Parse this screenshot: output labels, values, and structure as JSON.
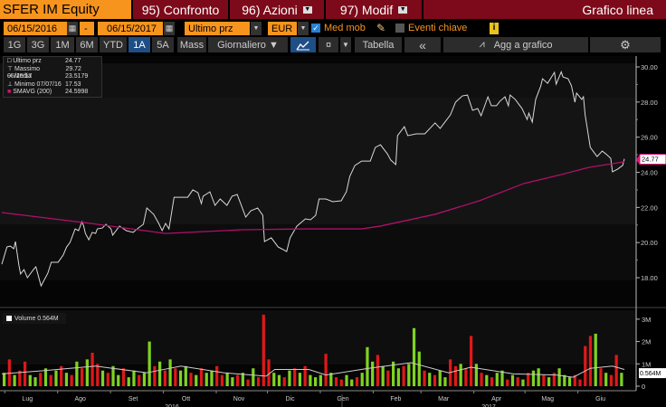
{
  "header": {
    "ticker": "SFER IM Equity",
    "compare": "95) Confronto",
    "actions": "96) Azioni",
    "modify": "97) Modif",
    "chart_type": "Grafico linea"
  },
  "controls": {
    "start_date": "06/15/2016",
    "dash": "-",
    "end_date": "06/15/2017",
    "field": "Ultimo prz",
    "currency": "EUR",
    "moving_avg_label": "Med mob",
    "moving_avg_checked": true,
    "key_events_label": "Eventi chiave",
    "key_events_checked": false,
    "info": "i"
  },
  "toolbar": {
    "periods": [
      "1G",
      "3G",
      "1M",
      "6M",
      "YTD",
      "1A",
      "5A",
      "Mass"
    ],
    "active_period": "1A",
    "frequency": "Giornaliero ▼",
    "table": "Tabella",
    "collapse": "«",
    "add_to_chart": "Agg a grafico"
  },
  "legend": {
    "items": [
      {
        "label": "Ultimo prz",
        "value": "24.77",
        "color": "#ffffff"
      },
      {
        "label": "Massimo 05/10/17",
        "value": "29.72"
      },
      {
        "label": "Media",
        "value": "23.5179"
      },
      {
        "label": "Minimo 07/07/16",
        "value": "17.53"
      },
      {
        "label": "SMAVG (200)",
        "value": "24.5998",
        "color": "#e0107a"
      }
    ]
  },
  "volume_legend": "Volume 0.564M",
  "chart_data": [
    {
      "type": "line",
      "title": "SFER IM Equity - Ultimo prz",
      "x_unit": "days since 06/15/2016",
      "ylim": [
        17,
        30.8
      ],
      "y_ticks": [
        "18.00",
        "20.00",
        "22.00",
        "24.00",
        "26.00",
        "28.00",
        "30.00"
      ],
      "y_tick_values": [
        18,
        20,
        22,
        24,
        26,
        28,
        30
      ],
      "last_label": "24.77",
      "series": [
        {
          "name": "Ultimo prz",
          "color": "#d8d8d8",
          "points": [
            [
              0,
              18.77
            ],
            [
              3,
              19.75
            ],
            [
              5,
              19.8
            ],
            [
              7,
              19.65
            ],
            [
              8,
              20.06
            ],
            [
              10,
              18.72
            ],
            [
              11,
              18.21
            ],
            [
              13,
              18.46
            ],
            [
              15,
              18.0
            ],
            [
              19,
              18.52
            ],
            [
              20,
              18.62
            ],
            [
              23,
              17.53
            ],
            [
              27,
              18.26
            ],
            [
              29,
              18.88
            ],
            [
              33,
              18.88
            ],
            [
              36,
              19.29
            ],
            [
              38,
              19.75
            ],
            [
              40,
              20.01
            ],
            [
              43,
              20.78
            ],
            [
              45,
              20.68
            ],
            [
              47,
              21.19
            ],
            [
              48,
              20.94
            ],
            [
              49,
              20.52
            ],
            [
              51,
              20.16
            ],
            [
              53,
              20.58
            ],
            [
              55,
              20.52
            ],
            [
              56,
              20.78
            ],
            [
              59,
              20.83
            ],
            [
              61,
              21.04
            ],
            [
              64,
              20.78
            ],
            [
              65,
              20.42
            ],
            [
              69,
              20.94
            ],
            [
              73,
              20.68
            ],
            [
              77,
              20.58
            ],
            [
              80,
              20.83
            ],
            [
              83,
              21.04
            ],
            [
              85,
              21.97
            ],
            [
              89,
              21.61
            ],
            [
              92,
              21.09
            ],
            [
              94,
              20.68
            ],
            [
              96,
              21.09
            ],
            [
              98,
              20.78
            ],
            [
              101,
              22.58
            ],
            [
              105,
              22.58
            ],
            [
              109,
              22.58
            ],
            [
              112,
              23.0
            ],
            [
              115,
              22.84
            ],
            [
              117,
              22.22
            ],
            [
              118,
              22.64
            ],
            [
              122,
              22.89
            ],
            [
              125,
              22.12
            ],
            [
              128,
              22.48
            ],
            [
              132,
              22.12
            ],
            [
              135,
              22.64
            ],
            [
              138,
              22.74
            ],
            [
              141,
              21.97
            ],
            [
              143,
              21.45
            ],
            [
              146,
              21.81
            ],
            [
              150,
              21.97
            ],
            [
              153,
              21.55
            ],
            [
              154,
              20.06
            ],
            [
              158,
              20.27
            ],
            [
              162,
              19.75
            ],
            [
              164,
              19.65
            ],
            [
              167,
              19.49
            ],
            [
              169,
              20.27
            ],
            [
              173,
              20.94
            ],
            [
              178,
              21.35
            ],
            [
              181,
              21.3
            ],
            [
              184,
              21.55
            ],
            [
              186,
              22.48
            ],
            [
              190,
              22.48
            ],
            [
              194,
              22.33
            ],
            [
              199,
              22.38
            ],
            [
              202,
              22.89
            ],
            [
              204,
              23.77
            ],
            [
              207,
              24.39
            ],
            [
              211,
              24.64
            ],
            [
              216,
              24.64
            ],
            [
              219,
              25.42
            ],
            [
              222,
              25.57
            ],
            [
              224,
              25.31
            ],
            [
              226,
              25.06
            ],
            [
              228,
              24.7
            ],
            [
              231,
              24.44
            ],
            [
              232,
              26.09
            ],
            [
              236,
              26.6
            ],
            [
              238,
              26.09
            ],
            [
              243,
              26.19
            ],
            [
              248,
              26.19
            ],
            [
              254,
              26.81
            ],
            [
              257,
              26.5
            ],
            [
              263,
              27.27
            ],
            [
              266,
              27.99
            ],
            [
              270,
              28.35
            ],
            [
              273,
              28.4
            ],
            [
              276,
              27.53
            ],
            [
              279,
              27.63
            ],
            [
              281,
              27.22
            ],
            [
              285,
              28.3
            ],
            [
              287,
              27.79
            ],
            [
              290,
              27.79
            ],
            [
              292,
              28.04
            ],
            [
              295,
              28.3
            ],
            [
              297,
              27.79
            ],
            [
              298,
              28.4
            ],
            [
              301,
              28.15
            ],
            [
              305,
              27.63
            ],
            [
              308,
              27.01
            ],
            [
              309,
              27.37
            ],
            [
              311,
              26.86
            ],
            [
              313,
              28.15
            ],
            [
              316,
              28.92
            ],
            [
              317,
              29.33
            ],
            [
              320,
              29.07
            ],
            [
              324,
              29.69
            ],
            [
              325,
              29.02
            ],
            [
              328,
              29.72
            ],
            [
              329,
              29.43
            ],
            [
              332,
              29.33
            ],
            [
              334,
              28.92
            ],
            [
              336,
              27.99
            ],
            [
              337,
              28.51
            ],
            [
              340,
              28.15
            ],
            [
              341,
              28.3
            ],
            [
              342,
              27.27
            ],
            [
              345,
              25.42
            ],
            [
              349,
              24.9
            ],
            [
              352,
              25.21
            ],
            [
              354,
              25.06
            ],
            [
              357,
              24.8
            ],
            [
              358,
              24.03
            ],
            [
              361,
              24.18
            ],
            [
              364,
              24.39
            ],
            [
              365,
              24.77
            ]
          ]
        },
        {
          "name": "SMAVG (200)",
          "color": "#b0106a",
          "points": [
            [
              0,
              21.71
            ],
            [
              52,
              21.09
            ],
            [
              96,
              20.52
            ],
            [
              141,
              20.73
            ],
            [
              179,
              20.78
            ],
            [
              211,
              20.78
            ],
            [
              222,
              20.94
            ],
            [
              254,
              21.61
            ],
            [
              280,
              22.38
            ],
            [
              306,
              23.36
            ],
            [
              328,
              23.87
            ],
            [
              344,
              24.28
            ],
            [
              365,
              24.6
            ]
          ]
        }
      ]
    },
    {
      "type": "bar",
      "title": "Volume",
      "ylim": [
        0,
        3.4
      ],
      "y_ticks": [
        "0",
        "1M",
        "2M",
        "3M"
      ],
      "y_tick_values": [
        0,
        1,
        2,
        3
      ],
      "last_label": "0.564M",
      "values": [
        0.6,
        1.2,
        0.5,
        0.7,
        1.1,
        0.5,
        0.4,
        0.6,
        0.8,
        0.5,
        0.7,
        0.9,
        0.6,
        0.5,
        1.1,
        0.8,
        1.2,
        1.5,
        1.0,
        0.7,
        0.6,
        0.9,
        0.5,
        0.8,
        0.4,
        0.7,
        0.5,
        0.6,
        2.0,
        0.9,
        1.1,
        0.7,
        1.2,
        0.8,
        0.7,
        0.9,
        0.6,
        0.5,
        0.8,
        0.6,
        0.7,
        0.9,
        0.5,
        0.6,
        0.4,
        0.5,
        0.6,
        0.3,
        0.8,
        0.4,
        3.2,
        1.2,
        0.6,
        0.5,
        0.4,
        0.7,
        0.8,
        0.6,
        0.9,
        0.5,
        0.4,
        0.5,
        1.45,
        0.6,
        0.4,
        0.3,
        0.5,
        0.3,
        0.4,
        0.6,
        1.75,
        1.1,
        1.4,
        0.9,
        0.7,
        1.1,
        0.8,
        0.9,
        1.0,
        2.6,
        1.55,
        0.7,
        0.6,
        0.5,
        0.7,
        0.4,
        1.2,
        0.9,
        1.0,
        0.8,
        2.25,
        1.0,
        0.6,
        0.5,
        0.4,
        0.6,
        0.7,
        0.3,
        0.5,
        0.4,
        0.3,
        0.6,
        0.7,
        0.8,
        0.5,
        0.4,
        0.6,
        0.8,
        0.5,
        0.4,
        0.5,
        0.3,
        1.8,
        2.25,
        2.35,
        0.8,
        0.6,
        0.5,
        1.4,
        0.6
      ],
      "direction": "grgrrggrgrgrgrgrgrrgrggrggrggrgrgrggrgrggrrggrgrgrrrggrgrgrgggrgrrggrgggrgrggrgggrgrggrrgrrgrgrggrgrgrggrgrgggrrrrgrgrrg",
      "up_color": "#7ed321",
      "down_color": "#e01818",
      "ma": {
        "name": "Volume MA",
        "color": "#cccccc",
        "points": [
          [
            0,
            0.55
          ],
          [
            25,
            0.7
          ],
          [
            55,
            0.9
          ],
          [
            85,
            0.6
          ],
          [
            105,
            0.9
          ],
          [
            130,
            0.6
          ],
          [
            155,
            0.45
          ],
          [
            160,
            0.75
          ],
          [
            180,
            0.75
          ],
          [
            190,
            0.5
          ],
          [
            215,
            0.8
          ],
          [
            240,
            1.05
          ],
          [
            262,
            0.6
          ],
          [
            275,
            0.85
          ],
          [
            300,
            0.55
          ],
          [
            325,
            0.5
          ],
          [
            335,
            0.4
          ],
          [
            345,
            0.8
          ],
          [
            358,
            0.9
          ],
          [
            365,
            0.75
          ]
        ]
      }
    }
  ],
  "x_axis": {
    "months": [
      "Lug",
      "Ago",
      "Set",
      "Ott",
      "Nov",
      "Dic",
      "Gen",
      "Feb",
      "Mar",
      "Apr",
      "Mag",
      "Giu"
    ],
    "month_days": [
      15,
      46,
      77,
      108,
      139,
      169,
      200,
      231,
      259,
      290,
      320,
      351
    ],
    "years": [
      "2016",
      "2017"
    ]
  }
}
